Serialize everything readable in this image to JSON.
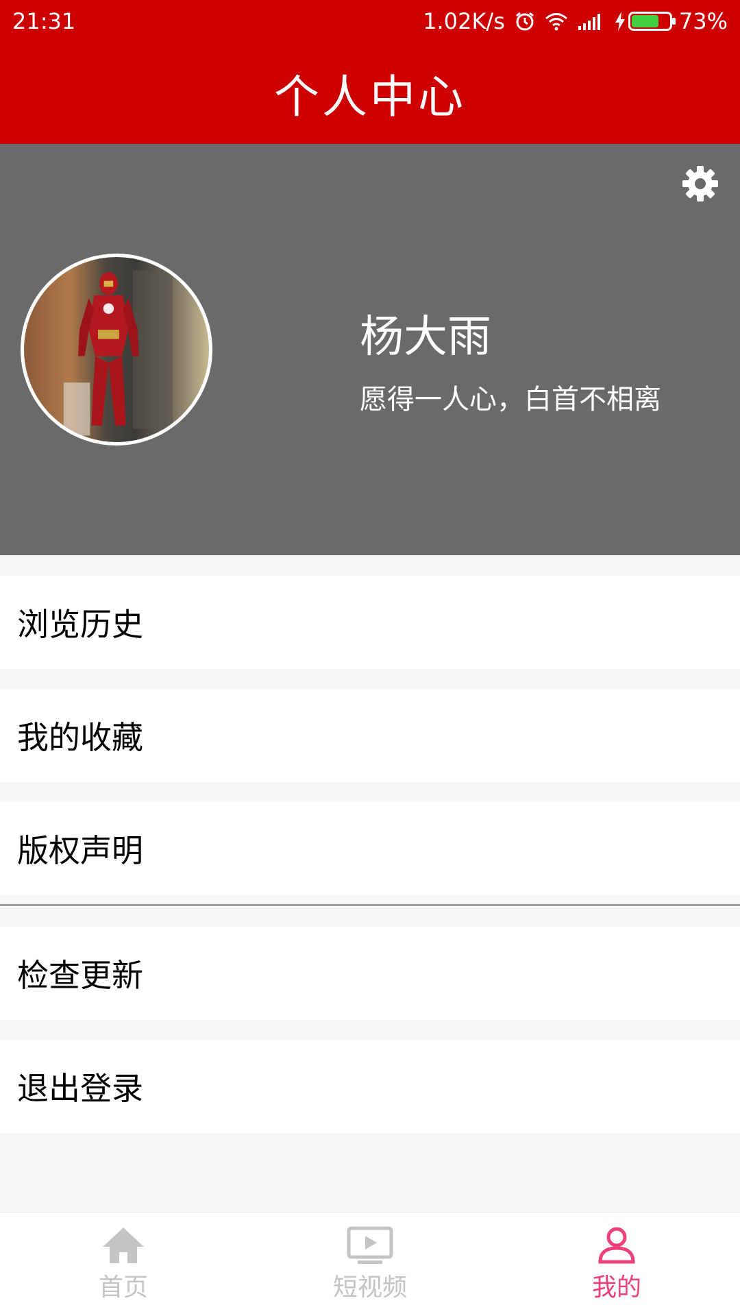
{
  "status_bar": {
    "time": "21:31",
    "speed": "1.02K/s",
    "battery": "73%",
    "battery_level": 0.73,
    "battery_color": "#3fd13f",
    "icons": [
      "alarm-icon",
      "wifi-icon",
      "signal-icon",
      "charging-icon",
      "battery-icon"
    ]
  },
  "app_bar": {
    "title": "个人中心",
    "background": "#cc0000"
  },
  "profile": {
    "name": "杨大雨",
    "motto": "愿得一人心，白首不相离",
    "settings_icon": "gear-icon",
    "background": "#6a6a6a"
  },
  "menu": {
    "items": [
      {
        "label": "浏览历史"
      },
      {
        "label": "我的收藏"
      },
      {
        "label": "版权声明"
      },
      {
        "label": "检查更新"
      },
      {
        "label": "退出登录"
      }
    ]
  },
  "bottom_nav": {
    "active_color": "#ec407a",
    "inactive_color": "#c4c4c4",
    "items": [
      {
        "label": "首页",
        "icon": "home-icon"
      },
      {
        "label": "短视频",
        "icon": "video-icon"
      },
      {
        "label": "我的",
        "icon": "user-icon",
        "active": true
      }
    ]
  }
}
